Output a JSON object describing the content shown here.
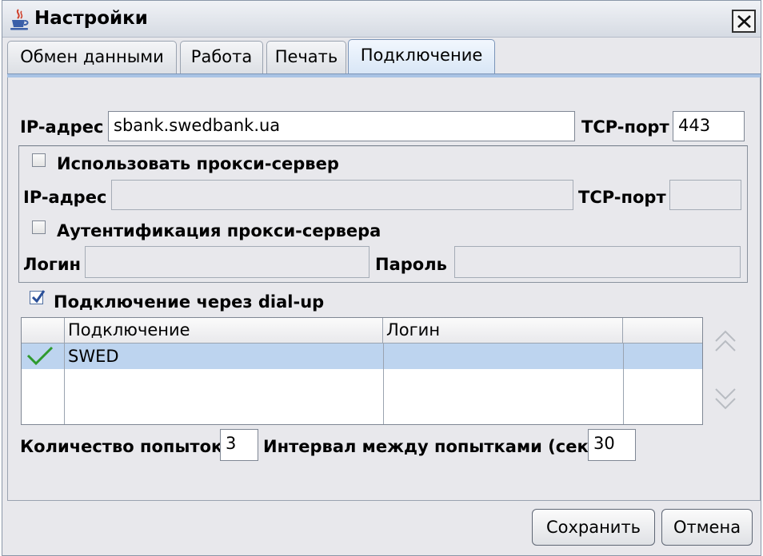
{
  "window": {
    "title": "Настройки",
    "app_icon": "java-cup-icon",
    "close_icon": "close-icon"
  },
  "tabs": [
    {
      "label": "Обмен данными",
      "active": false
    },
    {
      "label": "Работа",
      "active": false
    },
    {
      "label": "Печать",
      "active": false
    },
    {
      "label": "Подключение",
      "active": true
    }
  ],
  "connection": {
    "ip_label": "IP-адрес",
    "ip_value": "sbank.swedbank.ua",
    "port_label": "TCP-порт",
    "port_value": "443"
  },
  "proxy": {
    "use_label": "Использовать прокси-сервер",
    "use_checked": false,
    "ip_label": "IP-адрес",
    "ip_value": "",
    "port_label": "TCP-порт",
    "port_value": "",
    "auth_label": "Аутентификация прокси-сервера",
    "auth_checked": false,
    "login_label": "Логин",
    "login_value": "",
    "password_label": "Пароль",
    "password_value": ""
  },
  "dialup": {
    "label": "Подключение через dial-up",
    "checked": true,
    "columns": [
      "",
      "Подключение",
      "Логин",
      ""
    ],
    "rows": [
      {
        "selected": true,
        "status_icon": "checkmark-icon",
        "connection": "SWED",
        "login": ""
      }
    ],
    "move_up_icon": "double-chevron-up-icon",
    "move_down_icon": "double-chevron-down-icon"
  },
  "retry": {
    "attempts_label": "Количество попыток",
    "attempts_value": "3",
    "interval_label": "Интервал между попытками (сек.)",
    "interval_value": "30"
  },
  "buttons": {
    "save": "Сохранить",
    "cancel": "Отмена"
  },
  "colors": {
    "active_tab": "#d8e6f6",
    "selected_row": "#bdd4ef",
    "checkmark": "#2e9a2e"
  }
}
